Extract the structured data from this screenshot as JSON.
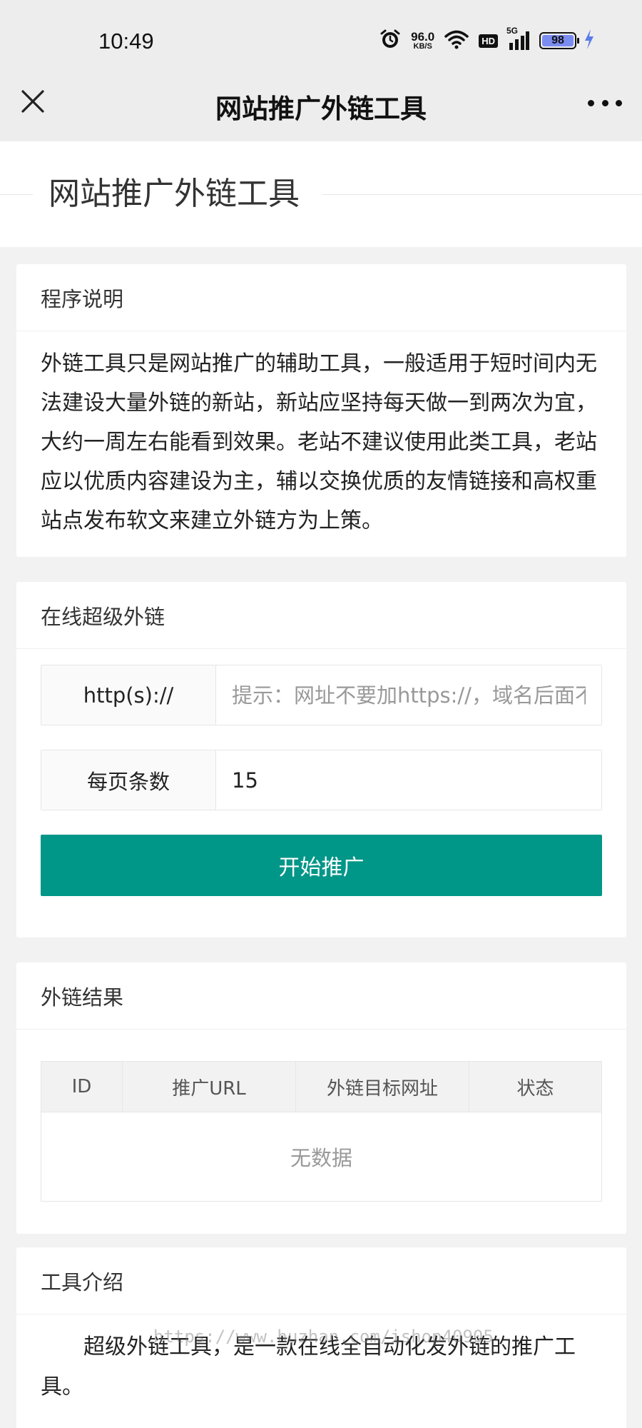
{
  "status_bar": {
    "time": "10:49",
    "net_speed_value": "96.0",
    "net_speed_unit": "KB/S",
    "hd_label": "HD",
    "signal_label": "5G",
    "battery_level": "98",
    "icons": [
      "alarm-icon",
      "wifi-icon",
      "cellular-signal-icon",
      "battery-icon",
      "charging-bolt-icon"
    ]
  },
  "nav": {
    "title": "网站推广外链工具",
    "close_icon": "close-icon",
    "more_icon": "more-icon"
  },
  "page_header": {
    "title": "网站推广外链工具"
  },
  "program_desc": {
    "header": "程序说明",
    "text": "外链工具只是网站推广的辅助工具，一般适用于短时间内无法建设大量外链的新站，新站应坚持每天做一到两次为宜，大约一周左右能看到效果。老站不建议使用此类工具，老站应以优质内容建设为主，辅以交换优质的友情链接和高权重站点发布软文来建立外链方为上策。"
  },
  "online_links": {
    "header": "在线超级外链",
    "url_label": "http(s)://",
    "url_placeholder": "提示：网址不要加https://，域名后面不要加/",
    "url_value": "",
    "per_page_label": "每页条数",
    "per_page_value": "15",
    "submit_label": "开始推广"
  },
  "results": {
    "header": "外链结果",
    "columns": [
      "ID",
      "推广URL",
      "外链目标网址",
      "状态"
    ],
    "empty_text": "无数据"
  },
  "intro": {
    "header": "工具介绍",
    "text": "超级外链工具，是一款在线全自动化发外链的推广工具。"
  },
  "watermark": "https://www.huzhan.com/ishop40905"
}
